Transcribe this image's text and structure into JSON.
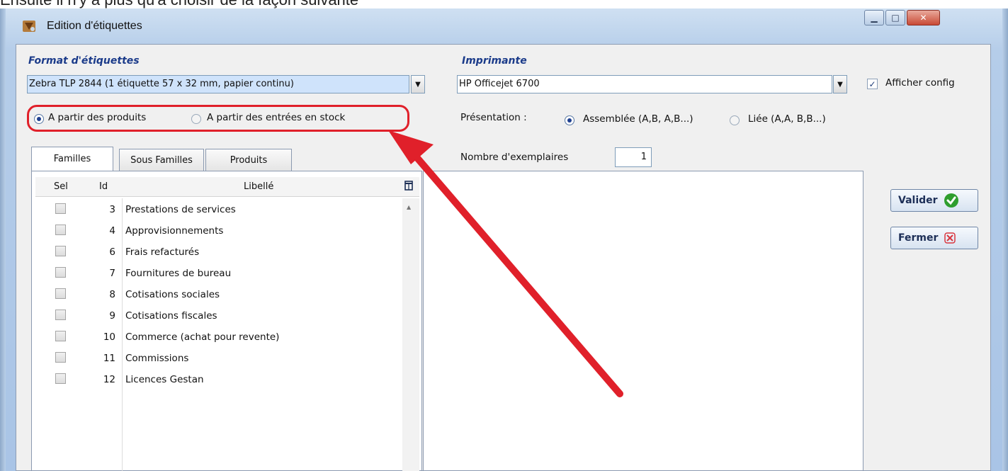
{
  "window": {
    "title": "Edition d'étiquettes",
    "top_crop_text": "Ensuite il n'y a plus qu'à choisir de la façon suivante"
  },
  "format": {
    "title": "Format d'étiquettes",
    "value": "Zebra TLP 2844 (1 étiquette  57 x 32 mm, papier continu)"
  },
  "source": {
    "option_products": "A partir des produits",
    "option_stock": "A partir des entrées en stock"
  },
  "printer": {
    "title": "Imprimante",
    "value": "HP Officejet 6700",
    "show_config_label": "Afficher config",
    "presentation_label": "Présentation :",
    "option_assembled": "Assemblée (A,B, A,B...)",
    "option_linked": "Liée (A,A,  B,B...)",
    "copies_label": "Nombre d'exemplaires",
    "copies_value": "1"
  },
  "tabs": [
    "Familles",
    "Sous Familles",
    "Produits"
  ],
  "grid": {
    "headers": {
      "sel": "Sel",
      "id": "Id",
      "label": "Libellé"
    },
    "rows": [
      {
        "id": "3",
        "label": "Prestations de services"
      },
      {
        "id": "4",
        "label": "Approvisionnements"
      },
      {
        "id": "6",
        "label": "Frais refacturés"
      },
      {
        "id": "7",
        "label": "Fournitures de bureau"
      },
      {
        "id": "8",
        "label": "Cotisations sociales"
      },
      {
        "id": "9",
        "label": "Cotisations fiscales"
      },
      {
        "id": "10",
        "label": "Commerce (achat pour revente)"
      },
      {
        "id": "11",
        "label": "Commissions"
      },
      {
        "id": "12",
        "label": "Licences Gestan"
      }
    ]
  },
  "actions": {
    "validate": "Valider",
    "close": "Fermer"
  },
  "colors": {
    "accent_title": "#1b3b8a",
    "highlight": "#e0202a",
    "validate_icon": "#2e9e2e",
    "close_icon": "#d9363e"
  }
}
